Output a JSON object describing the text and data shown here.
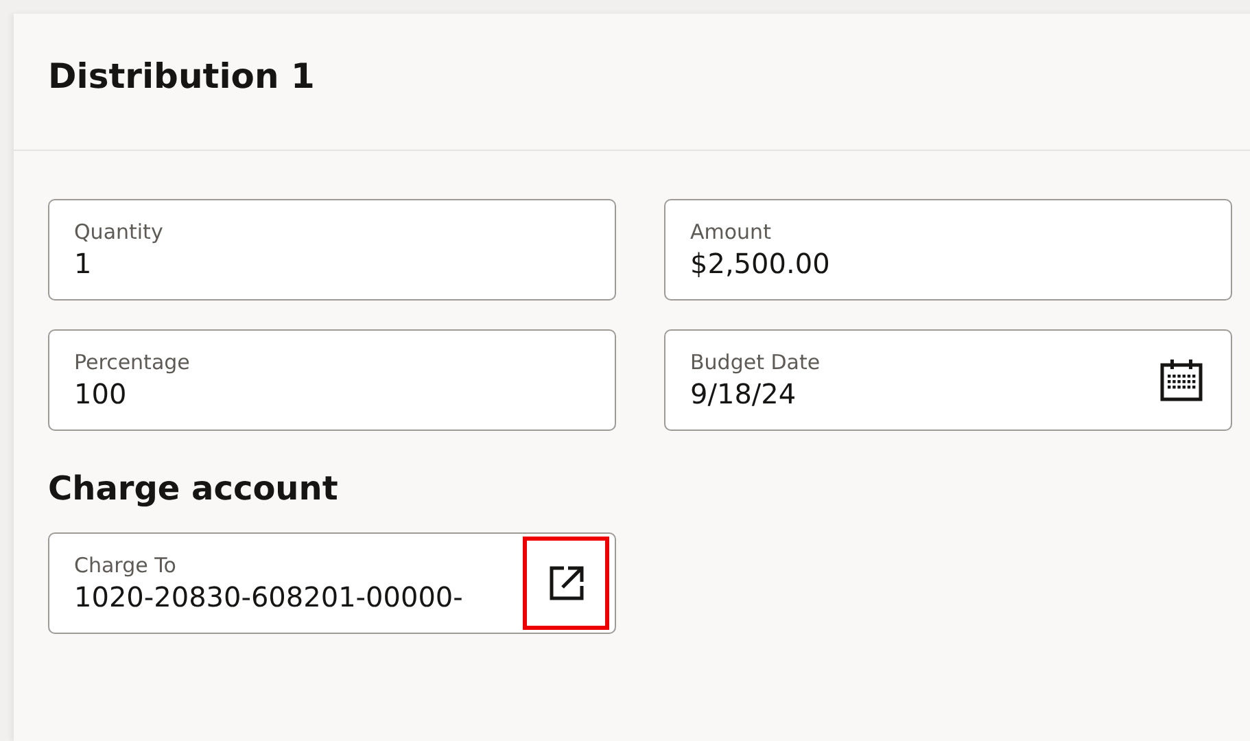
{
  "panel": {
    "title": "Distribution 1"
  },
  "fields": [
    {
      "kind": "text",
      "label": "Quantity",
      "value": "1"
    },
    {
      "kind": "text",
      "label": "Amount",
      "value": "$2,500.00"
    },
    {
      "kind": "text",
      "label": "Percentage",
      "value": "100"
    },
    {
      "kind": "date",
      "label": "Budget Date",
      "value": "9/18/24"
    }
  ],
  "charge_section": {
    "title": "Charge account",
    "fields": [
      {
        "kind": "link",
        "label": "Charge To",
        "value": "1020-20830-608201-00000-",
        "highlighted": true
      }
    ]
  }
}
